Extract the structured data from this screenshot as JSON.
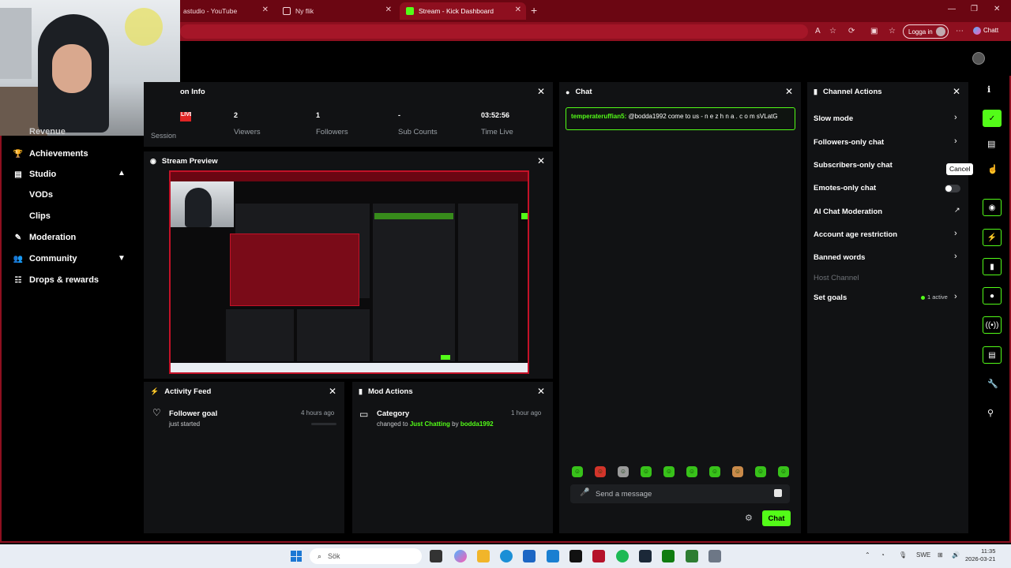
{
  "browser": {
    "tabs": [
      {
        "label": "astudio - YouTube",
        "active": false
      },
      {
        "label": "Ny flik",
        "active": false
      },
      {
        "label": "Stream - Kick Dashboard",
        "active": true
      }
    ],
    "login_label": "Logga in",
    "chat_label": "Chatt"
  },
  "sidebar": {
    "partial_label": "Revenue",
    "items": [
      {
        "label": "Achievements",
        "icon": "trophy-icon"
      },
      {
        "label": "Studio",
        "icon": "studio-icon"
      },
      {
        "label": "VODs"
      },
      {
        "label": "Clips"
      },
      {
        "label": "Moderation",
        "icon": "wrench-icon"
      },
      {
        "label": "Community",
        "icon": "people-icon"
      },
      {
        "label": "Drops & rewards",
        "icon": "gift-icon"
      }
    ]
  },
  "session": {
    "title": "on Info",
    "live_badge": "LIVE",
    "session_label": "Session",
    "stats": [
      {
        "value": "2",
        "label": "Viewers"
      },
      {
        "value": "1",
        "label": "Followers"
      },
      {
        "value": "-",
        "label": "Sub Counts"
      },
      {
        "value": "03:52:56",
        "label": "Time Live"
      }
    ]
  },
  "preview": {
    "title": "Stream Preview"
  },
  "activity": {
    "title": "Activity Feed",
    "items": [
      {
        "title": "Follower goal",
        "sub": "just started",
        "time": "4 hours ago"
      }
    ]
  },
  "mod_actions": {
    "title": "Mod Actions",
    "items": [
      {
        "title": "Category",
        "prefix": "changed to ",
        "category": "Just Chatting",
        "by": " by ",
        "user": "bodda1992",
        "time": "1 hour ago"
      }
    ]
  },
  "chat": {
    "title": "Chat",
    "messages": [
      {
        "user": "temperateruffian5:",
        "text": " @bodda1992 come to us - n e z h n a . c o m sVLatG"
      }
    ],
    "input_placeholder": "Send a message",
    "send_label": "Chat"
  },
  "channel_actions": {
    "title": "Channel Actions",
    "rows": [
      {
        "label": "Slow mode"
      },
      {
        "label": "Followers-only chat"
      },
      {
        "label": "Subscribers-only chat"
      },
      {
        "label": "Emotes-only chat"
      },
      {
        "label": "AI Chat Moderation"
      },
      {
        "label": "Account age restriction"
      },
      {
        "label": "Banned words"
      },
      {
        "label": "Host Channel"
      },
      {
        "label": "Set goals"
      }
    ],
    "tooltip": "Cancel",
    "goals_status": "1 active"
  },
  "taskbar": {
    "search_label": "Sök",
    "lang": "SWE",
    "time": "11:35",
    "date": "2026-03-21"
  },
  "colors": {
    "accent": "#53fc18",
    "chrome": "#8e0f1f",
    "panel": "#111214"
  }
}
